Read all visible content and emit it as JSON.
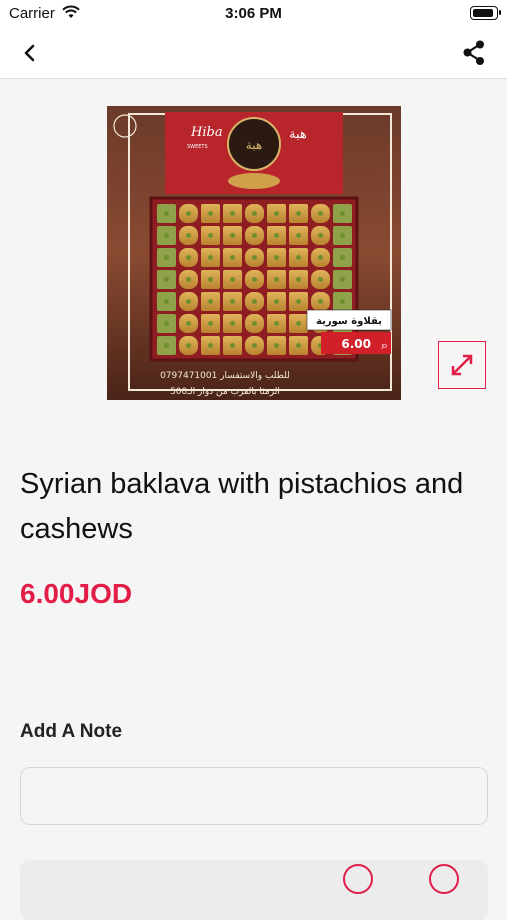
{
  "status_bar": {
    "carrier": "Carrier",
    "time": "3:06 PM",
    "battery_level": 1.0
  },
  "nav": {
    "back_icon": "chevron-left-icon",
    "share_icon": "share-icon"
  },
  "product": {
    "name": "Syrian baklava with pistachios and cashews",
    "price": "6.00JOD",
    "image_texts": {
      "brand_latin": "Hiba",
      "brand_sub": "SWEETS",
      "brand_arabic": "هبة",
      "tag_arabic": "بقلاوة سورية",
      "tag_price": "6.00",
      "tag_currency": "JD",
      "contact_line": "للطلب والاستفسار 0797471001",
      "address_line": "الرمثا بالقرب من دوار الـ500"
    },
    "expand_icon": "expand-arrows-icon"
  },
  "note": {
    "label": "Add A Note",
    "placeholder": ""
  },
  "colors": {
    "accent": "#e11d48",
    "background": "#f5f5f5"
  }
}
